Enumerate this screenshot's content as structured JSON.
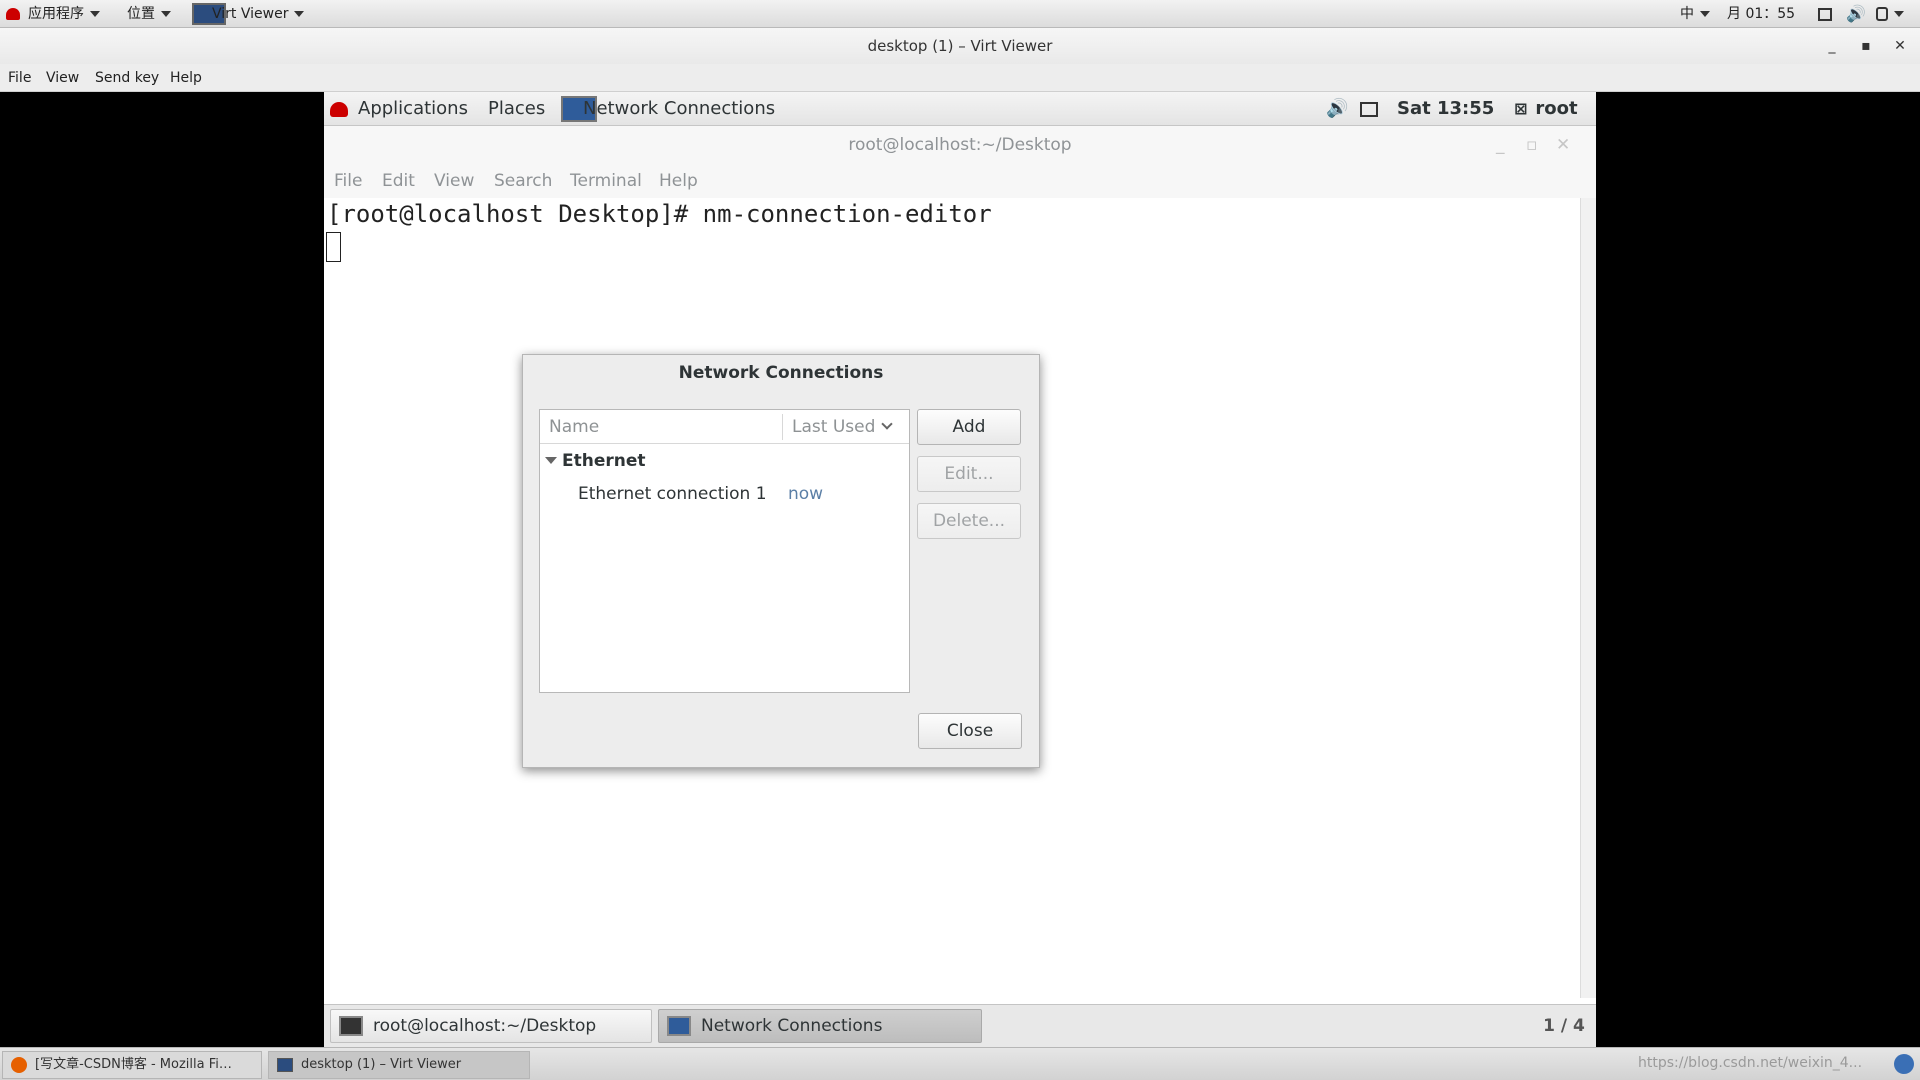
{
  "host_panel": {
    "applications": "应用程序",
    "places": "位置",
    "active_app": "Virt Viewer",
    "input_method": "中",
    "clock": "月 01：55"
  },
  "viewer": {
    "title": "desktop (1) – Virt Viewer",
    "menu": [
      "File",
      "View",
      "Send key",
      "Help"
    ]
  },
  "guest_panel": {
    "applications": "Applications",
    "places": "Places",
    "active_app": "Network Connections",
    "clock": "Sat 13:55",
    "user": "root"
  },
  "terminal": {
    "title": "root@localhost:~/Desktop",
    "menu": [
      "File",
      "Edit",
      "View",
      "Search",
      "Terminal",
      "Help"
    ],
    "prompt_line": "[root@localhost Desktop]# nm-connection-editor"
  },
  "dialog": {
    "title": "Network Connections",
    "columns": {
      "name": "Name",
      "last_used": "Last Used"
    },
    "group": "Ethernet",
    "connection": {
      "name": "Ethernet connection 1",
      "last_used": "now"
    },
    "buttons": {
      "add": "Add",
      "edit": "Edit...",
      "delete": "Delete...",
      "close": "Close"
    }
  },
  "guest_taskbar": {
    "tasks": [
      "root@localhost:~/Desktop",
      "Network Connections"
    ],
    "pager": "1 / 4"
  },
  "host_taskbar": {
    "tasks": [
      "[写文章-CSDN博客 - Mozilla Fi…",
      "desktop (1) – Virt Viewer"
    ],
    "watermark": "https://blog.csdn.net/weixin_4..."
  },
  "colors": {
    "accent_link": "#5b7fa6",
    "guest_bg": "#ffffff",
    "host_bg": "#000000"
  }
}
